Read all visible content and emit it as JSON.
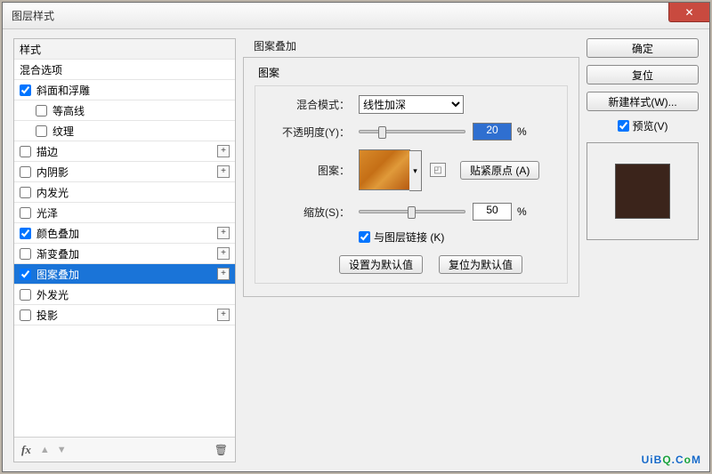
{
  "window": {
    "title": "图层样式"
  },
  "styles": {
    "header": "样式",
    "blending": "混合选项",
    "items": [
      {
        "key": "bevel",
        "label": "斜面和浮雕",
        "checked": true,
        "expandable": false
      },
      {
        "key": "contour",
        "label": "等高线",
        "checked": false,
        "indent": true
      },
      {
        "key": "texture",
        "label": "纹理",
        "checked": false,
        "indent": true
      },
      {
        "key": "stroke",
        "label": "描边",
        "checked": false,
        "expandable": true
      },
      {
        "key": "innerShadow",
        "label": "内阴影",
        "checked": false,
        "expandable": true
      },
      {
        "key": "innerGlow",
        "label": "内发光",
        "checked": false
      },
      {
        "key": "satin",
        "label": "光泽",
        "checked": false
      },
      {
        "key": "colorOverlay",
        "label": "颜色叠加",
        "checked": true,
        "expandable": true
      },
      {
        "key": "gradOverlay",
        "label": "渐变叠加",
        "checked": false,
        "expandable": true
      },
      {
        "key": "patOverlay",
        "label": "图案叠加",
        "checked": true,
        "expandable": true,
        "selected": true
      },
      {
        "key": "outerGlow",
        "label": "外发光",
        "checked": false
      },
      {
        "key": "dropShadow",
        "label": "投影",
        "checked": false,
        "expandable": true
      }
    ]
  },
  "panel": {
    "groupTitle": "图案叠加",
    "subTitle": "图案",
    "blendModeLabel": "混合模式：",
    "blendModeValue": "线性加深",
    "opacityLabel": "不透明度(Y)：",
    "opacityValue": "20",
    "pct": "%",
    "patternLabel": "图案：",
    "snapBtn": "贴紧原点 (A)",
    "scaleLabel": "缩放(S)：",
    "scaleValue": "50",
    "linkLabel": "与图层链接 (K)",
    "setDefault": "设置为默认值",
    "resetDefault": "复位为默认值"
  },
  "right": {
    "ok": "确定",
    "reset": "复位",
    "newStyle": "新建样式(W)...",
    "preview": "预览(V)"
  },
  "watermark": {
    "a": "UiB",
    "b": "Q",
    "c": ".C",
    "d": "o",
    "e": "M"
  }
}
